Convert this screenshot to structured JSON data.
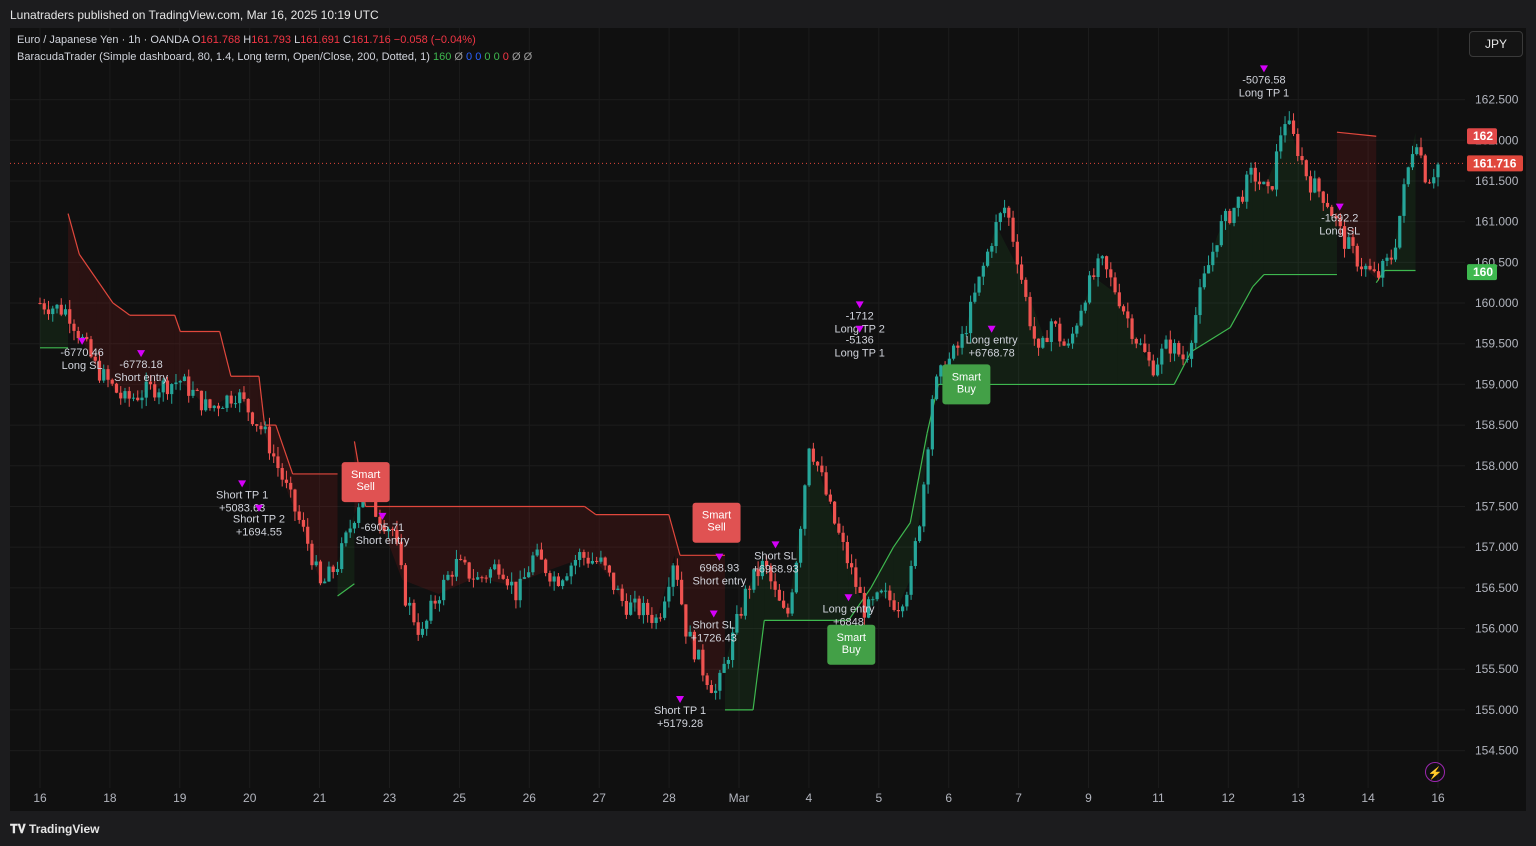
{
  "header": {
    "publisher": "Lunatraders published on TradingView.com, Mar 16, 2025 10:19 UTC"
  },
  "footer": {
    "logo": "TradingView"
  },
  "currency_button": "JPY",
  "legend": {
    "symbol": "Euro / Japanese Yen · 1h · OANDA",
    "open_label": "O",
    "open": "161.768",
    "high_label": "H",
    "high": "161.793",
    "low_label": "L",
    "low": "161.691",
    "close_label": "C",
    "close": "161.716",
    "change": "−0.058 (−0.04%)",
    "indicator": "BaracudaTrader (Simple dashboard, 80, 1.4, Long term, Open/Close, 200, Dotted, 1)",
    "ind_value": "160",
    "ind_flags": [
      "Ø",
      "0",
      "0",
      "0",
      "0",
      "0",
      "Ø",
      "Ø"
    ],
    "ind_flag_colors": [
      "#9b9b9b",
      "#2962ff",
      "#2962ff",
      "#3eb84f",
      "#3eb84f",
      "#f23645",
      "#9b9b9b",
      "#9b9b9b"
    ]
  },
  "colors": {
    "up": "#26a69a",
    "down": "#ef5350",
    "bg": "#101010",
    "grid": "#1c1c1c",
    "stop_long": "#3eb84f",
    "stop_short": "#e0473c",
    "text": "#d1d4dc",
    "signal": "#d500f9"
  },
  "chart_data": {
    "type": "candlestick",
    "title": "Euro / Japanese Yen · 1h · OANDA",
    "y_axis": {
      "ticks": [
        "162.500",
        "162.000",
        "161.500",
        "161.000",
        "160.500",
        "160.000",
        "159.500",
        "159.000",
        "158.500",
        "158.000",
        "157.500",
        "157.000",
        "156.500",
        "156.000",
        "155.500",
        "155.000",
        "154.500"
      ],
      "range": [
        154.2,
        162.95
      ]
    },
    "x_axis": {
      "ticks": [
        "16",
        "18",
        "19",
        "20",
        "21",
        "23",
        "25",
        "26",
        "27",
        "28",
        "Mar",
        "4",
        "5",
        "6",
        "7",
        "9",
        "11",
        "12",
        "13",
        "14",
        "16"
      ]
    },
    "price_path": [
      {
        "t": 0,
        "p": 160.0
      },
      {
        "t": 0.5,
        "p": 159.9
      },
      {
        "t": 1.0,
        "p": 159.2
      },
      {
        "t": 1.5,
        "p": 158.8
      },
      {
        "t": 2.0,
        "p": 158.95
      },
      {
        "t": 2.5,
        "p": 159.05
      },
      {
        "t": 3.0,
        "p": 158.7
      },
      {
        "t": 3.5,
        "p": 158.9
      },
      {
        "t": 4.0,
        "p": 158.4
      },
      {
        "t": 4.4,
        "p": 157.7
      },
      {
        "t": 4.8,
        "p": 157.0
      },
      {
        "t": 5.0,
        "p": 156.5
      },
      {
        "t": 5.3,
        "p": 156.8
      },
      {
        "t": 5.5,
        "p": 157.2
      },
      {
        "t": 5.8,
        "p": 157.8
      },
      {
        "t": 6.0,
        "p": 157.4
      },
      {
        "t": 6.3,
        "p": 157.2
      },
      {
        "t": 6.5,
        "p": 156.4
      },
      {
        "t": 6.8,
        "p": 155.9
      },
      {
        "t": 7.0,
        "p": 156.3
      },
      {
        "t": 7.4,
        "p": 156.8
      },
      {
        "t": 7.8,
        "p": 156.6
      },
      {
        "t": 8.2,
        "p": 156.8
      },
      {
        "t": 8.5,
        "p": 156.4
      },
      {
        "t": 8.8,
        "p": 156.9
      },
      {
        "t": 9.2,
        "p": 156.6
      },
      {
        "t": 9.6,
        "p": 156.9
      },
      {
        "t": 10.0,
        "p": 156.8
      },
      {
        "t": 10.4,
        "p": 156.3
      },
      {
        "t": 10.8,
        "p": 156.2
      },
      {
        "t": 11.0,
        "p": 156.1
      },
      {
        "t": 11.3,
        "p": 156.9
      },
      {
        "t": 11.5,
        "p": 156.0
      },
      {
        "t": 11.8,
        "p": 155.5
      },
      {
        "t": 12.05,
        "p": 155.2
      },
      {
        "t": 12.3,
        "p": 155.8
      },
      {
        "t": 12.6,
        "p": 156.5
      },
      {
        "t": 12.9,
        "p": 156.8
      },
      {
        "t": 13.1,
        "p": 156.4
      },
      {
        "t": 13.3,
        "p": 156.1
      },
      {
        "t": 13.5,
        "p": 157.0
      },
      {
        "t": 13.7,
        "p": 158.3
      },
      {
        "t": 13.9,
        "p": 157.9
      },
      {
        "t": 14.1,
        "p": 157.4
      },
      {
        "t": 14.4,
        "p": 156.8
      },
      {
        "t": 14.7,
        "p": 156.2
      },
      {
        "t": 15.0,
        "p": 156.4
      },
      {
        "t": 15.3,
        "p": 156.3
      },
      {
        "t": 15.5,
        "p": 156.6
      },
      {
        "t": 15.7,
        "p": 157.5
      },
      {
        "t": 15.9,
        "p": 158.9
      },
      {
        "t": 16.1,
        "p": 159.2
      },
      {
        "t": 16.4,
        "p": 159.5
      },
      {
        "t": 16.7,
        "p": 160.2
      },
      {
        "t": 17.0,
        "p": 160.9
      },
      {
        "t": 17.2,
        "p": 161.2
      },
      {
        "t": 17.4,
        "p": 160.6
      },
      {
        "t": 17.6,
        "p": 159.9
      },
      {
        "t": 17.8,
        "p": 159.3
      },
      {
        "t": 18.0,
        "p": 159.8
      },
      {
        "t": 18.3,
        "p": 159.4
      },
      {
        "t": 18.6,
        "p": 160.1
      },
      {
        "t": 18.9,
        "p": 160.5
      },
      {
        "t": 19.2,
        "p": 160.1
      },
      {
        "t": 19.5,
        "p": 159.6
      },
      {
        "t": 19.8,
        "p": 159.2
      },
      {
        "t": 20.1,
        "p": 159.5
      },
      {
        "t": 20.4,
        "p": 159.3
      },
      {
        "t": 20.7,
        "p": 160.2
      },
      {
        "t": 21.0,
        "p": 160.9
      },
      {
        "t": 21.3,
        "p": 161.2
      },
      {
        "t": 21.6,
        "p": 161.6
      },
      {
        "t": 21.9,
        "p": 161.3
      },
      {
        "t": 22.15,
        "p": 162.3
      },
      {
        "t": 22.4,
        "p": 161.9
      },
      {
        "t": 22.6,
        "p": 161.5
      },
      {
        "t": 22.9,
        "p": 161.3
      },
      {
        "t": 23.2,
        "p": 160.8
      },
      {
        "t": 23.5,
        "p": 160.5
      },
      {
        "t": 23.8,
        "p": 160.3
      },
      {
        "t": 24.1,
        "p": 160.6
      },
      {
        "t": 24.3,
        "p": 161.4
      },
      {
        "t": 24.5,
        "p": 162.1
      },
      {
        "t": 24.7,
        "p": 161.5
      },
      {
        "t": 24.9,
        "p": 161.7
      }
    ],
    "stop_line": [
      {
        "t": 0.0,
        "p": 159.45,
        "side": "long"
      },
      {
        "t": 0.5,
        "p": 159.45,
        "side": "long"
      },
      {
        "t": 0.5,
        "p": 161.1,
        "side": "short"
      },
      {
        "t": 0.7,
        "p": 160.6,
        "side": "short"
      },
      {
        "t": 1.0,
        "p": 160.3,
        "side": "short"
      },
      {
        "t": 1.3,
        "p": 160.0,
        "side": "short"
      },
      {
        "t": 1.6,
        "p": 159.85,
        "side": "short"
      },
      {
        "t": 2.4,
        "p": 159.85,
        "side": "short"
      },
      {
        "t": 2.5,
        "p": 159.65,
        "side": "short"
      },
      {
        "t": 3.2,
        "p": 159.65,
        "side": "short"
      },
      {
        "t": 3.4,
        "p": 159.1,
        "side": "short"
      },
      {
        "t": 3.9,
        "p": 159.1,
        "side": "short"
      },
      {
        "t": 4.0,
        "p": 158.5,
        "side": "short"
      },
      {
        "t": 4.2,
        "p": 158.5,
        "side": "short"
      },
      {
        "t": 4.5,
        "p": 157.9,
        "side": "short"
      },
      {
        "t": 5.3,
        "p": 157.9,
        "side": "short"
      },
      {
        "t": 5.3,
        "p": 156.4,
        "side": "long"
      },
      {
        "t": 5.6,
        "p": 156.55,
        "side": "long"
      },
      {
        "t": 5.6,
        "p": 158.3,
        "side": "short"
      },
      {
        "t": 5.8,
        "p": 157.5,
        "side": "short"
      },
      {
        "t": 9.7,
        "p": 157.5,
        "side": "short"
      },
      {
        "t": 9.9,
        "p": 157.4,
        "side": "short"
      },
      {
        "t": 11.2,
        "p": 157.4,
        "side": "short"
      },
      {
        "t": 11.4,
        "p": 156.9,
        "side": "short"
      },
      {
        "t": 12.2,
        "p": 156.9,
        "side": "short"
      },
      {
        "t": 12.2,
        "p": 155.0,
        "side": "long"
      },
      {
        "t": 12.7,
        "p": 155.0,
        "side": "long"
      },
      {
        "t": 12.9,
        "p": 156.1,
        "side": "long"
      },
      {
        "t": 14.2,
        "p": 156.1,
        "side": "long"
      },
      {
        "t": 14.4,
        "p": 156.1,
        "side": "long"
      },
      {
        "t": 14.8,
        "p": 156.5,
        "side": "long"
      },
      {
        "t": 15.2,
        "p": 157.0,
        "side": "long"
      },
      {
        "t": 15.5,
        "p": 157.3,
        "side": "long"
      },
      {
        "t": 15.8,
        "p": 158.4,
        "side": "long"
      },
      {
        "t": 16.0,
        "p": 159.0,
        "side": "long"
      },
      {
        "t": 16.3,
        "p": 159.0,
        "side": "long"
      },
      {
        "t": 16.6,
        "p": 159.0,
        "side": "long"
      },
      {
        "t": 19.2,
        "p": 159.0,
        "side": "long"
      },
      {
        "t": 20.2,
        "p": 159.0,
        "side": "long"
      },
      {
        "t": 20.5,
        "p": 159.4,
        "side": "long"
      },
      {
        "t": 21.2,
        "p": 159.7,
        "side": "long"
      },
      {
        "t": 21.6,
        "p": 160.2,
        "side": "long"
      },
      {
        "t": 21.8,
        "p": 160.35,
        "side": "long"
      },
      {
        "t": 23.1,
        "p": 160.35,
        "side": "long"
      },
      {
        "t": 23.1,
        "p": 162.1,
        "side": "short"
      },
      {
        "t": 23.8,
        "p": 162.05,
        "side": "short"
      },
      {
        "t": 23.8,
        "p": 160.25,
        "side": "long"
      },
      {
        "t": 23.95,
        "p": 160.4,
        "side": "long"
      },
      {
        "t": 24.5,
        "p": 160.4,
        "side": "long"
      }
    ],
    "current_price": "161.716",
    "upper_badge": "162",
    "lower_badge": "160",
    "signals": [
      {
        "kind": "box",
        "text": [
          "Smart",
          "Sell"
        ],
        "t": 5.8,
        "p": 157.8,
        "color": "#e05252"
      },
      {
        "kind": "box",
        "text": [
          "Smart",
          "Sell"
        ],
        "t": 12.05,
        "p": 157.3,
        "color": "#e05252"
      },
      {
        "kind": "box",
        "text": [
          "Smart",
          "Buy"
        ],
        "t": 16.5,
        "p": 159.0,
        "color": "#43a047"
      },
      {
        "kind": "box",
        "text": [
          "Smart",
          "Buy"
        ],
        "t": 14.45,
        "p": 155.8,
        "color": "#43a047"
      },
      {
        "kind": "label",
        "text": [
          "-6770.46",
          "Long SL"
        ],
        "t": 0.75,
        "p": 159.35
      },
      {
        "kind": "label",
        "text": [
          "-6778.18",
          "Short entry"
        ],
        "t": 1.8,
        "p": 159.2
      },
      {
        "kind": "label",
        "text": [
          "Short TP 1",
          "+5083.63"
        ],
        "t": 3.6,
        "p": 157.6
      },
      {
        "kind": "label",
        "text": [
          "Short TP 2",
          "+1694.55"
        ],
        "t": 3.9,
        "p": 157.3
      },
      {
        "kind": "label",
        "text": [
          "-6905.71",
          "Short entry"
        ],
        "t": 6.1,
        "p": 157.2
      },
      {
        "kind": "label",
        "text": [
          "Short SL",
          "+1726.43"
        ],
        "t": 12.0,
        "p": 156.0
      },
      {
        "kind": "label",
        "text": [
          "6968.93",
          "Short entry"
        ],
        "t": 12.1,
        "p": 156.7
      },
      {
        "kind": "label",
        "text": [
          "Short SL",
          "+6968.93"
        ],
        "t": 13.1,
        "p": 156.85
      },
      {
        "kind": "label",
        "text": [
          "Short TP 1",
          "+5179.28"
        ],
        "t": 11.4,
        "p": 154.95
      },
      {
        "kind": "label",
        "text": [
          "Long entry",
          "+6848"
        ],
        "t": 14.4,
        "p": 156.2
      },
      {
        "kind": "label",
        "text": [
          "-1712",
          "Long TP 2"
        ],
        "t": 14.6,
        "p": 159.8
      },
      {
        "kind": "label",
        "text": [
          "-5136",
          "Long TP 1"
        ],
        "t": 14.6,
        "p": 159.5
      },
      {
        "kind": "label",
        "text": [
          "Long entry",
          "+6768.78"
        ],
        "t": 16.95,
        "p": 159.5
      },
      {
        "kind": "label",
        "text": [
          "-5076.58",
          "Long TP 1"
        ],
        "t": 21.8,
        "p": 162.7
      },
      {
        "kind": "label",
        "text": [
          "-1692.2",
          "Long SL"
        ],
        "t": 23.15,
        "p": 161.0
      }
    ]
  }
}
